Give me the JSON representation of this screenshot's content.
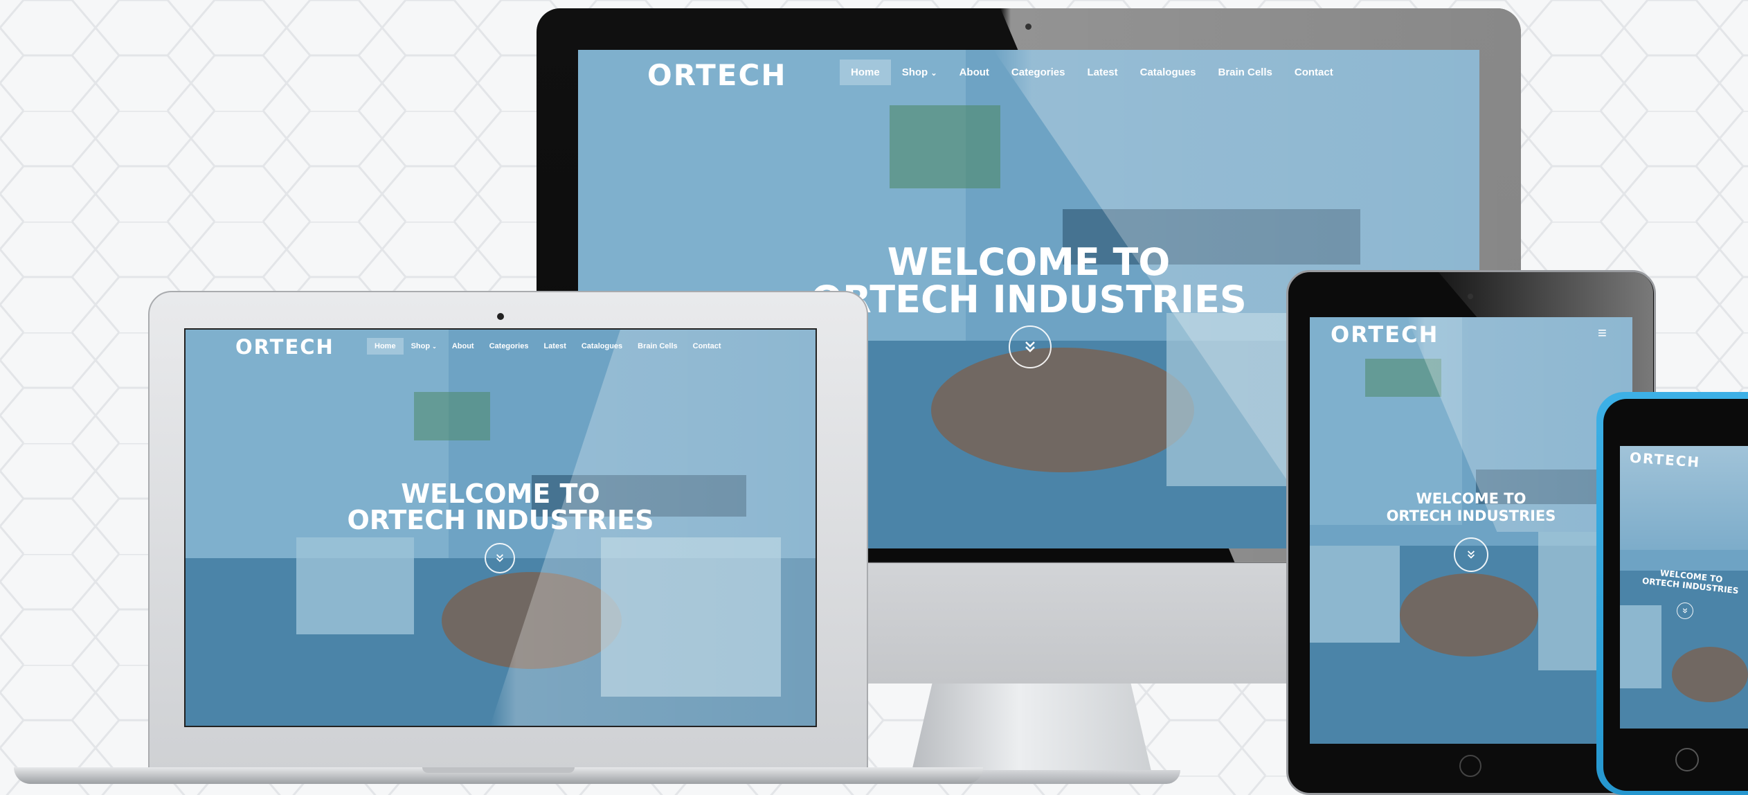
{
  "brand": {
    "logo": "ORTECH"
  },
  "navigation": {
    "items": [
      {
        "label": "Home",
        "active": true
      },
      {
        "label": "Shop",
        "dropdown": true
      },
      {
        "label": "About"
      },
      {
        "label": "Categories"
      },
      {
        "label": "Latest"
      },
      {
        "label": "Catalogues"
      },
      {
        "label": "Brain Cells"
      },
      {
        "label": "Contact"
      }
    ],
    "dropdown_icon": "chevron-down-icon",
    "mobile_menu_icon": "hamburger-icon"
  },
  "hero": {
    "line1": "WELCOME TO",
    "line2": "ORTECH INDUSTRIES",
    "scroll_icon": "double-chevron-down-icon"
  },
  "colors": {
    "overlay": "#5f9ec4",
    "text": "#ffffff",
    "phone_body": "#33a6dd",
    "tablet_body": "#0c0c0c",
    "monitor_bezel": "#0b0b0b",
    "aluminum": "#c9cbcf"
  }
}
